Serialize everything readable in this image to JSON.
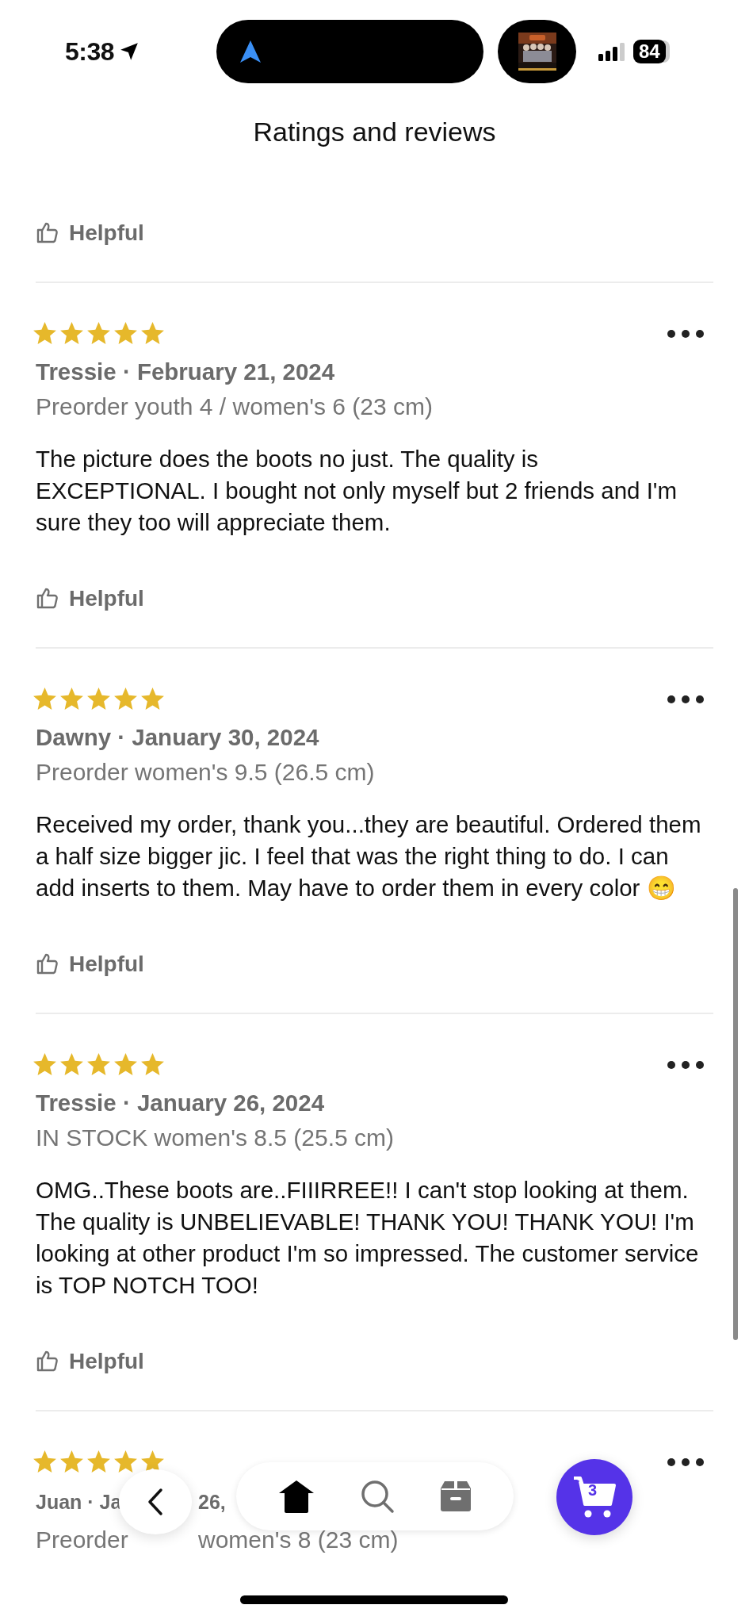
{
  "status_bar": {
    "time": "5:38",
    "battery": "84"
  },
  "header": {
    "title": "Ratings and reviews"
  },
  "top_helpful": {
    "label": "Helpful"
  },
  "reviews": [
    {
      "stars": 5,
      "meta": "Tressie · February 21, 2024",
      "variant": "Preorder youth 4 / women's 6 (23 cm)",
      "body": "The picture does the boots no just. The quality is EXCEPTIONAL. I bought not only myself but 2 friends and I'm sure they too will appreciate them.",
      "helpful": "Helpful"
    },
    {
      "stars": 5,
      "meta": "Dawny · January 30, 2024",
      "variant": "Preorder women's 9.5 (26.5 cm)",
      "body": "Received my order, thank you...they are beautiful. Ordered them a half size bigger jic. I feel that was the right thing to do. I can add inserts to them. May have to order them in every color 😁",
      "helpful": "Helpful"
    },
    {
      "stars": 5,
      "meta": "Tressie · January 26, 2024",
      "variant": "IN STOCK women's 8.5 (25.5 cm)",
      "body": "OMG..These boots are..FIIIRREE!! I can't stop looking at them. The quality is UNBELIEVABLE! THANK YOU! THANK YOU! I'm looking at other product I'm so impressed. The customer service is TOP NOTCH TOO!",
      "helpful": "Helpful"
    },
    {
      "stars": 5,
      "meta_parts": [
        "Juan · Ja",
        "26,"
      ],
      "variant_parts": [
        "Preorder",
        "women's 8 (23 cm)"
      ]
    }
  ],
  "nav": {
    "items": [
      {
        "kind": "home",
        "selected": true
      },
      {
        "kind": "search",
        "selected": false
      },
      {
        "kind": "orders",
        "selected": false
      }
    ],
    "cart_count": "3"
  }
}
